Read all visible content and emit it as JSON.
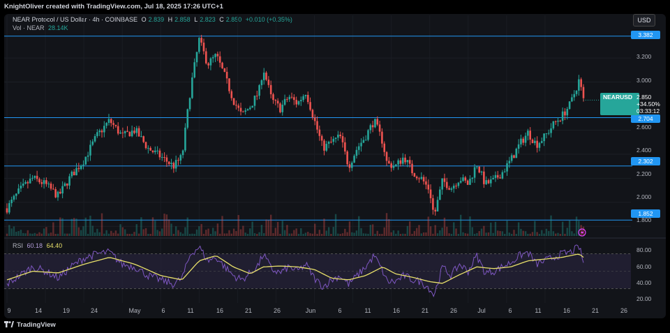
{
  "credit": "KnightOliver created with TradingView.com, Jul 18, 2025 17:26 UTC+1",
  "currency": "USD",
  "legend": {
    "title": "NEAR Protocol / US Dollar · 4h · COINBASE",
    "o_label": "O",
    "o": "2.839",
    "h_label": "H",
    "h": "2.858",
    "l_label": "L",
    "l": "2.823",
    "c_label": "C",
    "c": "2.850",
    "change": "+0.010 (+0.35%)",
    "vol_label": "Vol · NEAR",
    "vol": "28.14K"
  },
  "rsi_legend": {
    "label": "RSI",
    "rsi": "60.18",
    "ma": "64.40"
  },
  "quote": {
    "symbol": "NEARUSD",
    "price": "2.850",
    "pct": "+34.50%",
    "timer": "03:33:12"
  },
  "footer": "TradingView",
  "colors": {
    "up": "#26a69a",
    "down": "#ef5350",
    "level": "#2196f3",
    "rsi": "#7e57c2",
    "rsi_ma": "#e8e06a",
    "band": "#2a2540"
  },
  "chart_data": {
    "type": "candlestick",
    "price_ticks": [
      "3.200",
      "3.000",
      "2.600",
      "2.400",
      "2.200",
      "2.000",
      "1.800"
    ],
    "level_lines": [
      "3.382",
      "2.704",
      "2.302",
      "1.852"
    ],
    "price_ylim": [
      1.72,
      3.45
    ],
    "rsi_ticks": [
      "80.00",
      "60.00",
      "40.00",
      "20.00"
    ],
    "rsi_ylim": [
      15,
      85
    ],
    "rsi_band": [
      30,
      70
    ],
    "x_ticks": [
      "9",
      "14",
      "19",
      "24",
      "May",
      "6",
      "11",
      "16",
      "21",
      "26",
      "Jun",
      "6",
      "11",
      "16",
      "21",
      "26",
      "Jul",
      "6",
      "11",
      "16",
      "21",
      "26"
    ],
    "price_path": [
      [
        0,
        1.95
      ],
      [
        3,
        2.1
      ],
      [
        6,
        2.2
      ],
      [
        9,
        2.15
      ],
      [
        12,
        2.05
      ],
      [
        15,
        2.22
      ],
      [
        18,
        2.35
      ],
      [
        21,
        2.55
      ],
      [
        24,
        2.68
      ],
      [
        27,
        2.55
      ],
      [
        30,
        2.6
      ],
      [
        33,
        2.45
      ],
      [
        36,
        2.38
      ],
      [
        39,
        2.3
      ],
      [
        41,
        2.38
      ],
      [
        43,
        2.95
      ],
      [
        45,
        3.35
      ],
      [
        47,
        3.15
      ],
      [
        49,
        3.22
      ],
      [
        51,
        3.05
      ],
      [
        53,
        2.85
      ],
      [
        55,
        2.72
      ],
      [
        57,
        2.8
      ],
      [
        59,
        2.92
      ],
      [
        60,
        3.12
      ],
      [
        62,
        2.85
      ],
      [
        64,
        2.78
      ],
      [
        66,
        2.88
      ],
      [
        68,
        2.82
      ],
      [
        70,
        2.92
      ],
      [
        72,
        2.68
      ],
      [
        74,
        2.45
      ],
      [
        76,
        2.5
      ],
      [
        78,
        2.55
      ],
      [
        80,
        2.3
      ],
      [
        82,
        2.45
      ],
      [
        84,
        2.55
      ],
      [
        86,
        2.68
      ],
      [
        88,
        2.5
      ],
      [
        89,
        2.32
      ],
      [
        91,
        2.3
      ],
      [
        93,
        2.38
      ],
      [
        95,
        2.25
      ],
      [
        97,
        2.2
      ],
      [
        99,
        2.1
      ],
      [
        100,
        1.88
      ],
      [
        102,
        2.18
      ],
      [
        104,
        2.12
      ],
      [
        106,
        2.2
      ],
      [
        108,
        2.15
      ],
      [
        110,
        2.32
      ],
      [
        112,
        2.15
      ],
      [
        114,
        2.18
      ],
      [
        116,
        2.25
      ],
      [
        118,
        2.35
      ],
      [
        120,
        2.48
      ],
      [
        122,
        2.58
      ],
      [
        124,
        2.48
      ],
      [
        126,
        2.55
      ],
      [
        128,
        2.65
      ],
      [
        130,
        2.72
      ],
      [
        132,
        2.82
      ],
      [
        134,
        3.02
      ],
      [
        135,
        2.85
      ]
    ],
    "rsi_path": [
      [
        0,
        35
      ],
      [
        3,
        45
      ],
      [
        6,
        55
      ],
      [
        9,
        50
      ],
      [
        12,
        42
      ],
      [
        15,
        55
      ],
      [
        18,
        65
      ],
      [
        21,
        70
      ],
      [
        24,
        72
      ],
      [
        27,
        58
      ],
      [
        30,
        55
      ],
      [
        33,
        45
      ],
      [
        36,
        40
      ],
      [
        39,
        35
      ],
      [
        41,
        42
      ],
      [
        43,
        70
      ],
      [
        45,
        78
      ],
      [
        47,
        62
      ],
      [
        49,
        66
      ],
      [
        51,
        55
      ],
      [
        53,
        45
      ],
      [
        55,
        40
      ],
      [
        57,
        48
      ],
      [
        59,
        58
      ],
      [
        60,
        70
      ],
      [
        62,
        52
      ],
      [
        64,
        48
      ],
      [
        66,
        55
      ],
      [
        68,
        50
      ],
      [
        70,
        58
      ],
      [
        72,
        42
      ],
      [
        74,
        32
      ],
      [
        76,
        40
      ],
      [
        78,
        45
      ],
      [
        80,
        35
      ],
      [
        82,
        45
      ],
      [
        84,
        55
      ],
      [
        86,
        68
      ],
      [
        88,
        50
      ],
      [
        89,
        38
      ],
      [
        91,
        38
      ],
      [
        93,
        45
      ],
      [
        95,
        40
      ],
      [
        97,
        38
      ],
      [
        99,
        30
      ],
      [
        100,
        22
      ],
      [
        102,
        55
      ],
      [
        104,
        45
      ],
      [
        106,
        58
      ],
      [
        108,
        50
      ],
      [
        110,
        68
      ],
      [
        112,
        48
      ],
      [
        114,
        50
      ],
      [
        116,
        55
      ],
      [
        118,
        60
      ],
      [
        120,
        68
      ],
      [
        122,
        72
      ],
      [
        124,
        58
      ],
      [
        126,
        62
      ],
      [
        128,
        66
      ],
      [
        130,
        70
      ],
      [
        132,
        72
      ],
      [
        134,
        78
      ],
      [
        135,
        60
      ]
    ],
    "rsi_ma_path": [
      [
        0,
        40
      ],
      [
        6,
        50
      ],
      [
        12,
        48
      ],
      [
        18,
        58
      ],
      [
        24,
        66
      ],
      [
        30,
        58
      ],
      [
        36,
        45
      ],
      [
        41,
        40
      ],
      [
        45,
        62
      ],
      [
        49,
        68
      ],
      [
        53,
        55
      ],
      [
        57,
        47
      ],
      [
        60,
        55
      ],
      [
        64,
        56
      ],
      [
        68,
        55
      ],
      [
        72,
        52
      ],
      [
        76,
        42
      ],
      [
        80,
        40
      ],
      [
        84,
        45
      ],
      [
        88,
        55
      ],
      [
        91,
        47
      ],
      [
        95,
        43
      ],
      [
        99,
        38
      ],
      [
        102,
        36
      ],
      [
        106,
        46
      ],
      [
        110,
        55
      ],
      [
        114,
        53
      ],
      [
        118,
        55
      ],
      [
        122,
        62
      ],
      [
        126,
        64
      ],
      [
        130,
        66
      ],
      [
        134,
        70
      ],
      [
        135,
        66
      ]
    ]
  }
}
